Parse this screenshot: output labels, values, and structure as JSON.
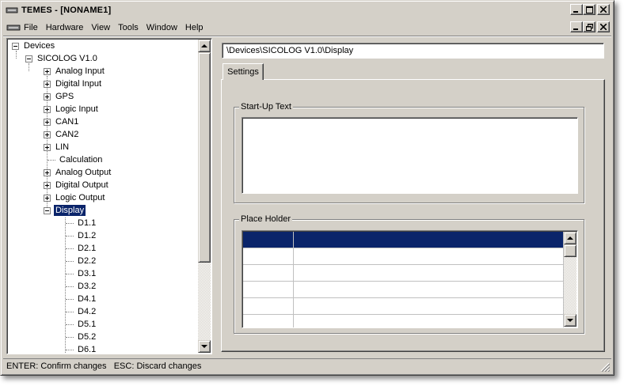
{
  "window": {
    "title": "TEMES - [NONAME1]"
  },
  "menu": {
    "items": [
      "File",
      "Hardware",
      "View",
      "Tools",
      "Window",
      "Help"
    ]
  },
  "tree": {
    "root": "Devices",
    "device": "SICOLOG V1.0",
    "children": [
      "Analog Input",
      "Digital Input",
      "GPS",
      "Logic Input",
      "CAN1",
      "CAN2",
      "LIN",
      "Calculation",
      "Analog Output",
      "Digital Output",
      "Logic Output",
      "Display"
    ],
    "selected": "Display",
    "display_children": [
      "D1.1",
      "D1.2",
      "D2.1",
      "D2.2",
      "D3.1",
      "D3.2",
      "D4.1",
      "D4.2",
      "D5.1",
      "D5.2",
      "D6.1"
    ]
  },
  "path": "\\Devices\\SICOLOG V1.0\\Display",
  "tabs": {
    "settings": "Settings"
  },
  "groups": {
    "startup_text": "Start-Up Text",
    "place_holder": "Place Holder"
  },
  "status": {
    "text": "ENTER: Confirm changes   ESC: Discard changes"
  },
  "colors": {
    "face": "#d4d0c8",
    "selection": "#0a246a"
  }
}
